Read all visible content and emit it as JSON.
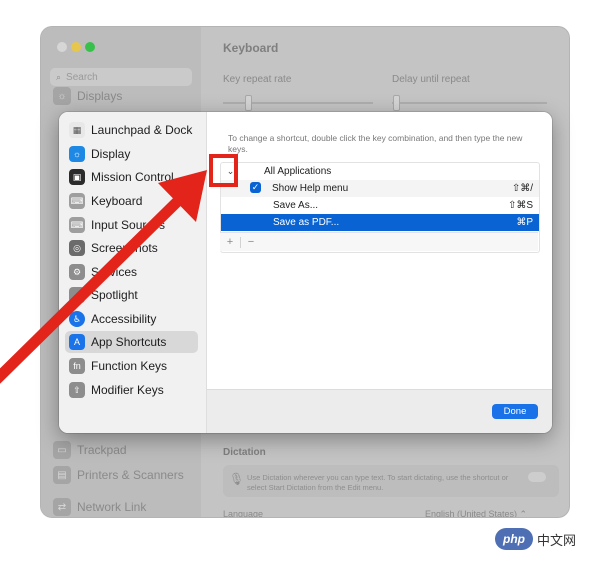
{
  "background": {
    "search_placeholder": "Search",
    "sidebar_items": [
      {
        "label": "Displays",
        "icon": "display-icon"
      },
      {
        "label": "Trackpad",
        "icon": "trackpad-icon"
      },
      {
        "label": "Printers & Scanners",
        "icon": "printer-icon"
      },
      {
        "label": "Network Link",
        "icon": "network-link-icon"
      }
    ],
    "title": "Keyboard",
    "key_repeat_label": "Key repeat rate",
    "delay_label": "Delay until repeat",
    "dictation_title": "Dictation",
    "dictation_desc": "Use Dictation wherever you can type text. To start dictating, use the shortcut or select Start Dictation from the Edit menu.",
    "language_label": "Language",
    "language_value": "English (United States)  ⌃"
  },
  "sheet": {
    "sidebar_items": [
      {
        "label": "Launchpad & Dock",
        "icon": "launchpad-icon",
        "color": "#e8e8e8"
      },
      {
        "label": "Display",
        "icon": "display-icon",
        "color": "#1e88e5"
      },
      {
        "label": "Mission Control",
        "icon": "mission-control-icon",
        "color": "#2b2b2b"
      },
      {
        "label": "Keyboard",
        "icon": "keyboard-icon",
        "color": "#9e9e9e"
      },
      {
        "label": "Input Sources",
        "icon": "input-sources-icon",
        "color": "#9e9e9e"
      },
      {
        "label": "Screenshots",
        "icon": "screenshots-icon",
        "color": "#6b6b6b"
      },
      {
        "label": "Services",
        "icon": "services-icon",
        "color": "#8d8d8d"
      },
      {
        "label": "Spotlight",
        "icon": "spotlight-icon",
        "color": "#8d8d8d"
      },
      {
        "label": "Accessibility",
        "icon": "accessibility-icon",
        "color": "#1a73e8"
      },
      {
        "label": "App Shortcuts",
        "icon": "app-shortcuts-icon",
        "color": "#1a73e8"
      },
      {
        "label": "Function Keys",
        "icon": "function-keys-icon",
        "color": "#8d8d8d"
      },
      {
        "label": "Modifier Keys",
        "icon": "modifier-keys-icon",
        "color": "#8d8d8d"
      }
    ],
    "selected_item": "App Shortcuts",
    "instructions": "To change a shortcut, double click the key combination, and then type the new keys.",
    "shortcuts": {
      "group_label": "All Applications",
      "rows": [
        {
          "label": "Show Help menu",
          "keys": "⇧⌘/",
          "checked": true
        },
        {
          "label": "Save As...",
          "keys": "⇧⌘S"
        },
        {
          "label": "Save as PDF...",
          "keys": "⌘P",
          "selected": true
        }
      ]
    },
    "add_label": "+",
    "remove_label": "−",
    "done_label": "Done"
  },
  "accent_color": "#0a63d2",
  "annotation_color": "#e2241b",
  "watermark": {
    "badge": "php",
    "text": "中文网"
  }
}
